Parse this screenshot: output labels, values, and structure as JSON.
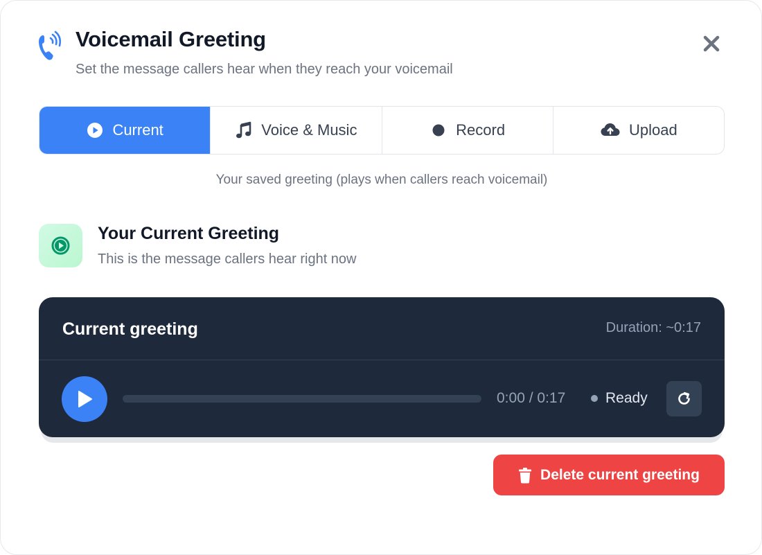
{
  "header": {
    "icon": "phone-ringing-icon",
    "title": "Voicemail Greeting",
    "subtitle": "Set the message callers hear when they reach your voicemail",
    "close_icon": "close-icon"
  },
  "tabs": [
    {
      "label": "Current",
      "icon": "play-circle-icon",
      "active": true
    },
    {
      "label": "Voice & Music",
      "icon": "music-note-icon",
      "active": false
    },
    {
      "label": "Record",
      "icon": "record-dot-icon",
      "active": false
    },
    {
      "label": "Upload",
      "icon": "cloud-upload-icon",
      "active": false
    }
  ],
  "hint": "Your saved greeting (plays when callers reach voicemail)",
  "current_greeting": {
    "icon": "play-circle-icon",
    "title": "Your Current Greeting",
    "subtitle": "This is the message callers hear right now"
  },
  "player": {
    "title": "Current greeting",
    "duration": "Duration: ~0:17",
    "time": "0:00 / 0:17",
    "progress_fraction": 0,
    "status": "Ready",
    "play_icon": "play-icon",
    "reload_icon": "reload-icon"
  },
  "actions": {
    "delete_label": "Delete current greeting",
    "delete_icon": "trash-icon"
  },
  "colors": {
    "accent": "#3b82f6",
    "player_bg": "#1e293b",
    "danger": "#ef4444",
    "success_bg": "#d1fae5",
    "success_icon": "#059669"
  }
}
